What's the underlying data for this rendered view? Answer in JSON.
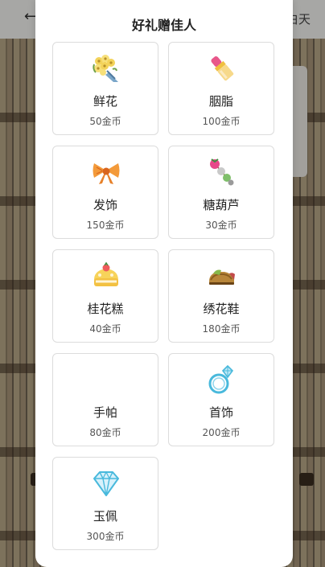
{
  "background": {
    "back_glyph": "←",
    "right_text": "白天"
  },
  "modal": {
    "title": "好礼赠佳人",
    "gifts": [
      {
        "name": "鲜花",
        "price": "50金币",
        "icon": "bouquet-icon"
      },
      {
        "name": "胭脂",
        "price": "100金币",
        "icon": "lipstick-icon"
      },
      {
        "name": "发饰",
        "price": "150金币",
        "icon": "bow-icon"
      },
      {
        "name": "糖葫芦",
        "price": "30金币",
        "icon": "candied-haws-icon"
      },
      {
        "name": "桂花糕",
        "price": "40金币",
        "icon": "cake-icon"
      },
      {
        "name": "绣花鞋",
        "price": "180金币",
        "icon": "embroidered-shoe-icon"
      },
      {
        "name": "手帕",
        "price": "80金币",
        "icon": "handkerchief-icon"
      },
      {
        "name": "首饰",
        "price": "200金币",
        "icon": "ring-icon"
      },
      {
        "name": "玉佩",
        "price": "300金币",
        "icon": "diamond-icon"
      }
    ]
  }
}
